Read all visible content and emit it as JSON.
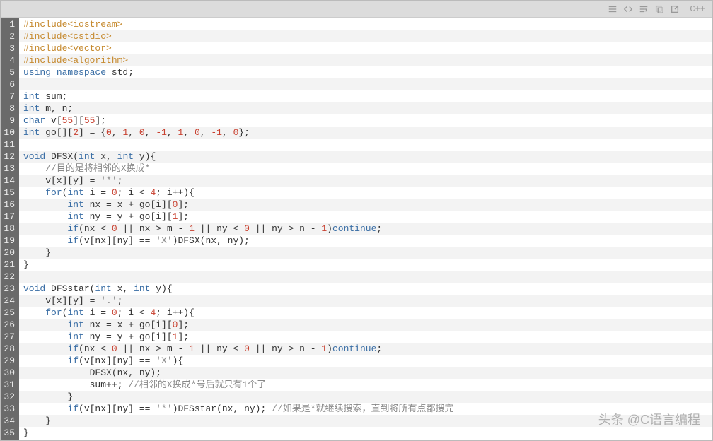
{
  "toolbar": {
    "language_label": "C++"
  },
  "watermark": "头条 @C语言编程",
  "colors": {
    "gutter_bg": "#6a6a6a",
    "gutter_fg": "#eaeaea",
    "row_alt": "#f3f3f3",
    "preproc": "#c68a2f",
    "keyword": "#3a6ea5",
    "number": "#c8402f",
    "comment": "#888888"
  },
  "code": [
    {
      "n": 1,
      "t": [
        {
          "c": "tk-preproc",
          "s": "#include<iostream>"
        }
      ]
    },
    {
      "n": 2,
      "t": [
        {
          "c": "tk-preproc",
          "s": "#include<cstdio>"
        }
      ]
    },
    {
      "n": 3,
      "t": [
        {
          "c": "tk-preproc",
          "s": "#include<vector>"
        }
      ]
    },
    {
      "n": 4,
      "t": [
        {
          "c": "tk-preproc",
          "s": "#include<algorithm>"
        }
      ]
    },
    {
      "n": 5,
      "t": [
        {
          "c": "tk-keyword",
          "s": "using "
        },
        {
          "c": "tk-keyword",
          "s": "namespace"
        },
        {
          "c": "tk-ident",
          "s": " std;"
        }
      ]
    },
    {
      "n": 6,
      "t": []
    },
    {
      "n": 7,
      "t": [
        {
          "c": "tk-type",
          "s": "int"
        },
        {
          "c": "tk-ident",
          "s": " sum;"
        }
      ]
    },
    {
      "n": 8,
      "t": [
        {
          "c": "tk-type",
          "s": "int"
        },
        {
          "c": "tk-ident",
          "s": " m, n;"
        }
      ]
    },
    {
      "n": 9,
      "t": [
        {
          "c": "tk-type",
          "s": "char"
        },
        {
          "c": "tk-ident",
          "s": " v["
        },
        {
          "c": "tk-number",
          "s": "55"
        },
        {
          "c": "tk-ident",
          "s": "]["
        },
        {
          "c": "tk-number",
          "s": "55"
        },
        {
          "c": "tk-ident",
          "s": "];"
        }
      ]
    },
    {
      "n": 10,
      "t": [
        {
          "c": "tk-type",
          "s": "int"
        },
        {
          "c": "tk-ident",
          "s": " go[]["
        },
        {
          "c": "tk-number",
          "s": "2"
        },
        {
          "c": "tk-ident",
          "s": "] = {"
        },
        {
          "c": "tk-number",
          "s": "0"
        },
        {
          "c": "tk-ident",
          "s": ", "
        },
        {
          "c": "tk-number",
          "s": "1"
        },
        {
          "c": "tk-ident",
          "s": ", "
        },
        {
          "c": "tk-number",
          "s": "0"
        },
        {
          "c": "tk-ident",
          "s": ", "
        },
        {
          "c": "tk-number",
          "s": "-1"
        },
        {
          "c": "tk-ident",
          "s": ", "
        },
        {
          "c": "tk-number",
          "s": "1"
        },
        {
          "c": "tk-ident",
          "s": ", "
        },
        {
          "c": "tk-number",
          "s": "0"
        },
        {
          "c": "tk-ident",
          "s": ", "
        },
        {
          "c": "tk-number",
          "s": "-1"
        },
        {
          "c": "tk-ident",
          "s": ", "
        },
        {
          "c": "tk-number",
          "s": "0"
        },
        {
          "c": "tk-ident",
          "s": "};"
        }
      ]
    },
    {
      "n": 11,
      "t": []
    },
    {
      "n": 12,
      "t": [
        {
          "c": "tk-type",
          "s": "void"
        },
        {
          "c": "tk-ident",
          "s": " DFSX("
        },
        {
          "c": "tk-type",
          "s": "int"
        },
        {
          "c": "tk-ident",
          "s": " x, "
        },
        {
          "c": "tk-type",
          "s": "int"
        },
        {
          "c": "tk-ident",
          "s": " y){"
        }
      ]
    },
    {
      "n": 13,
      "t": [
        {
          "c": "tk-ident",
          "s": "    "
        },
        {
          "c": "tk-comment",
          "s": "//目的是将相邻的X换成*"
        }
      ]
    },
    {
      "n": 14,
      "t": [
        {
          "c": "tk-ident",
          "s": "    v[x][y] = "
        },
        {
          "c": "tk-char",
          "s": "'*'"
        },
        {
          "c": "tk-ident",
          "s": ";"
        }
      ]
    },
    {
      "n": 15,
      "t": [
        {
          "c": "tk-ident",
          "s": "    "
        },
        {
          "c": "tk-keyword",
          "s": "for"
        },
        {
          "c": "tk-ident",
          "s": "("
        },
        {
          "c": "tk-type",
          "s": "int"
        },
        {
          "c": "tk-ident",
          "s": " i = "
        },
        {
          "c": "tk-number",
          "s": "0"
        },
        {
          "c": "tk-ident",
          "s": "; i < "
        },
        {
          "c": "tk-number",
          "s": "4"
        },
        {
          "c": "tk-ident",
          "s": "; i++){"
        }
      ]
    },
    {
      "n": 16,
      "t": [
        {
          "c": "tk-ident",
          "s": "        "
        },
        {
          "c": "tk-type",
          "s": "int"
        },
        {
          "c": "tk-ident",
          "s": " nx = x + go[i]["
        },
        {
          "c": "tk-number",
          "s": "0"
        },
        {
          "c": "tk-ident",
          "s": "];"
        }
      ]
    },
    {
      "n": 17,
      "t": [
        {
          "c": "tk-ident",
          "s": "        "
        },
        {
          "c": "tk-type",
          "s": "int"
        },
        {
          "c": "tk-ident",
          "s": " ny = y + go[i]["
        },
        {
          "c": "tk-number",
          "s": "1"
        },
        {
          "c": "tk-ident",
          "s": "];"
        }
      ]
    },
    {
      "n": 18,
      "t": [
        {
          "c": "tk-ident",
          "s": "        "
        },
        {
          "c": "tk-keyword",
          "s": "if"
        },
        {
          "c": "tk-ident",
          "s": "(nx < "
        },
        {
          "c": "tk-number",
          "s": "0"
        },
        {
          "c": "tk-ident",
          "s": " || nx > m - "
        },
        {
          "c": "tk-number",
          "s": "1"
        },
        {
          "c": "tk-ident",
          "s": " || ny < "
        },
        {
          "c": "tk-number",
          "s": "0"
        },
        {
          "c": "tk-ident",
          "s": " || ny > n - "
        },
        {
          "c": "tk-number",
          "s": "1"
        },
        {
          "c": "tk-ident",
          "s": ")"
        },
        {
          "c": "tk-keyword",
          "s": "continue"
        },
        {
          "c": "tk-ident",
          "s": ";"
        }
      ]
    },
    {
      "n": 19,
      "t": [
        {
          "c": "tk-ident",
          "s": "        "
        },
        {
          "c": "tk-keyword",
          "s": "if"
        },
        {
          "c": "tk-ident",
          "s": "(v[nx][ny] == "
        },
        {
          "c": "tk-char",
          "s": "'X'"
        },
        {
          "c": "tk-ident",
          "s": ")DFSX(nx, ny);"
        }
      ]
    },
    {
      "n": 20,
      "t": [
        {
          "c": "tk-ident",
          "s": "    }"
        }
      ]
    },
    {
      "n": 21,
      "t": [
        {
          "c": "tk-ident",
          "s": "}"
        }
      ]
    },
    {
      "n": 22,
      "t": []
    },
    {
      "n": 23,
      "t": [
        {
          "c": "tk-type",
          "s": "void"
        },
        {
          "c": "tk-ident",
          "s": " DFSstar("
        },
        {
          "c": "tk-type",
          "s": "int"
        },
        {
          "c": "tk-ident",
          "s": " x, "
        },
        {
          "c": "tk-type",
          "s": "int"
        },
        {
          "c": "tk-ident",
          "s": " y){"
        }
      ]
    },
    {
      "n": 24,
      "t": [
        {
          "c": "tk-ident",
          "s": "    v[x][y] = "
        },
        {
          "c": "tk-char",
          "s": "'.'"
        },
        {
          "c": "tk-ident",
          "s": ";"
        }
      ]
    },
    {
      "n": 25,
      "t": [
        {
          "c": "tk-ident",
          "s": "    "
        },
        {
          "c": "tk-keyword",
          "s": "for"
        },
        {
          "c": "tk-ident",
          "s": "("
        },
        {
          "c": "tk-type",
          "s": "int"
        },
        {
          "c": "tk-ident",
          "s": " i = "
        },
        {
          "c": "tk-number",
          "s": "0"
        },
        {
          "c": "tk-ident",
          "s": "; i < "
        },
        {
          "c": "tk-number",
          "s": "4"
        },
        {
          "c": "tk-ident",
          "s": "; i++){"
        }
      ]
    },
    {
      "n": 26,
      "t": [
        {
          "c": "tk-ident",
          "s": "        "
        },
        {
          "c": "tk-type",
          "s": "int"
        },
        {
          "c": "tk-ident",
          "s": " nx = x + go[i]["
        },
        {
          "c": "tk-number",
          "s": "0"
        },
        {
          "c": "tk-ident",
          "s": "];"
        }
      ]
    },
    {
      "n": 27,
      "t": [
        {
          "c": "tk-ident",
          "s": "        "
        },
        {
          "c": "tk-type",
          "s": "int"
        },
        {
          "c": "tk-ident",
          "s": " ny = y + go[i]["
        },
        {
          "c": "tk-number",
          "s": "1"
        },
        {
          "c": "tk-ident",
          "s": "];"
        }
      ]
    },
    {
      "n": 28,
      "t": [
        {
          "c": "tk-ident",
          "s": "        "
        },
        {
          "c": "tk-keyword",
          "s": "if"
        },
        {
          "c": "tk-ident",
          "s": "(nx < "
        },
        {
          "c": "tk-number",
          "s": "0"
        },
        {
          "c": "tk-ident",
          "s": " || nx > m - "
        },
        {
          "c": "tk-number",
          "s": "1"
        },
        {
          "c": "tk-ident",
          "s": " || ny < "
        },
        {
          "c": "tk-number",
          "s": "0"
        },
        {
          "c": "tk-ident",
          "s": " || ny > n - "
        },
        {
          "c": "tk-number",
          "s": "1"
        },
        {
          "c": "tk-ident",
          "s": ")"
        },
        {
          "c": "tk-keyword",
          "s": "continue"
        },
        {
          "c": "tk-ident",
          "s": ";"
        }
      ]
    },
    {
      "n": 29,
      "t": [
        {
          "c": "tk-ident",
          "s": "        "
        },
        {
          "c": "tk-keyword",
          "s": "if"
        },
        {
          "c": "tk-ident",
          "s": "(v[nx][ny] == "
        },
        {
          "c": "tk-char",
          "s": "'X'"
        },
        {
          "c": "tk-ident",
          "s": "){"
        }
      ]
    },
    {
      "n": 30,
      "t": [
        {
          "c": "tk-ident",
          "s": "            DFSX(nx, ny);"
        }
      ]
    },
    {
      "n": 31,
      "t": [
        {
          "c": "tk-ident",
          "s": "            sum++; "
        },
        {
          "c": "tk-comment",
          "s": "//相邻的X换成*号后就只有1个了"
        }
      ]
    },
    {
      "n": 32,
      "t": [
        {
          "c": "tk-ident",
          "s": "        }"
        }
      ]
    },
    {
      "n": 33,
      "t": [
        {
          "c": "tk-ident",
          "s": "        "
        },
        {
          "c": "tk-keyword",
          "s": "if"
        },
        {
          "c": "tk-ident",
          "s": "(v[nx][ny] == "
        },
        {
          "c": "tk-char",
          "s": "'*'"
        },
        {
          "c": "tk-ident",
          "s": ")DFSstar(nx, ny); "
        },
        {
          "c": "tk-comment",
          "s": "//如果是*就继续搜索，直到将所有点都搜完"
        }
      ]
    },
    {
      "n": 34,
      "t": [
        {
          "c": "tk-ident",
          "s": "    }"
        }
      ]
    },
    {
      "n": 35,
      "t": [
        {
          "c": "tk-ident",
          "s": "}"
        }
      ]
    }
  ]
}
